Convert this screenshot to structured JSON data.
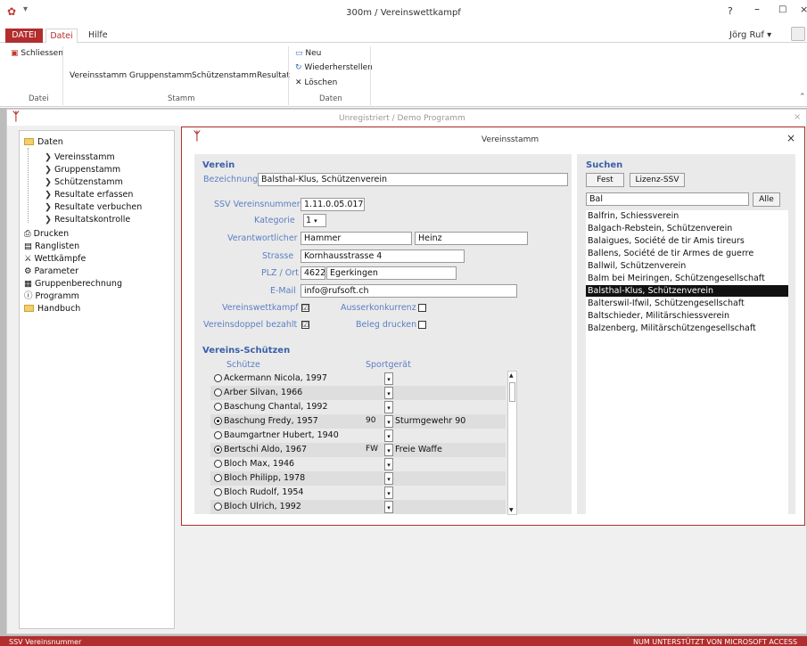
{
  "window": {
    "title": "300m / Vereinswettkampf",
    "help": "?",
    "minimize": "–",
    "maximize": "□",
    "close": "×",
    "user": "Jörg Ruf"
  },
  "ribbon": {
    "tabs": {
      "file": "DATEI",
      "datei": "Datei",
      "hilfe": "Hilfe"
    },
    "buttons": {
      "schliessen": "Schliessen",
      "vereinsstamm": "Vereinsstamm",
      "gruppenstamm": "Gruppenstamm",
      "schuetzenstamm": "Schützenstamm",
      "resultat": "Resultat",
      "neu": "Neu",
      "wiederherstellen": "Wiederherstellen",
      "loeschen": "Löschen"
    },
    "groups": {
      "datei": "Datei",
      "stamm": "Stamm",
      "daten": "Daten"
    }
  },
  "subwindow": {
    "title": "Unregistriert  /  Demo Programm",
    "close": "×"
  },
  "nav": {
    "daten": "Daten",
    "children": [
      "Vereinsstamm",
      "Gruppenstamm",
      "Schützenstamm",
      "Resultate erfassen",
      "Resultate verbuchen",
      "Resultatskontrolle"
    ],
    "drucken": "Drucken",
    "ranglisten": "Ranglisten",
    "wettkaempfe": "Wettkämpfe",
    "parameter": "Parameter",
    "gruppenberechnung": "Gruppenberechnung",
    "programm": "Programm",
    "handbuch": "Handbuch"
  },
  "dialog": {
    "title": "Vereinsstamm",
    "close": "×",
    "verein_section": "Verein",
    "labels": {
      "bezeichnung": "Bezeichnung",
      "ssv": "SSV Vereinsnummer",
      "kategorie": "Kategorie",
      "verantwortlicher": "Verantwortlicher",
      "strasse": "Strasse",
      "plz": "PLZ / Ort",
      "email": "E-Mail",
      "vereinswettkampf": "Vereinswettkampf",
      "ausserkonkurrenz": "Ausserkonkurrenz",
      "vereinsdoppel": "Vereinsdoppel bezahlt",
      "beleg": "Beleg drucken"
    },
    "values": {
      "bezeichnung": "Balsthal-Klus, Schützenverein",
      "ssv": "1.11.0.05.017",
      "kategorie": "1",
      "nachname": "Hammer",
      "vorname": "Heinz",
      "strasse": "Kornhausstrasse 4",
      "plz": "4622",
      "ort": "Egerkingen",
      "email": "info@rufsoft.ch"
    },
    "checks": {
      "vereinswettkampf": "☑",
      "ausserkonkurrenz": "",
      "vereinsdoppel": "☑",
      "beleg": ""
    },
    "schuetzen_section": "Vereins-Schützen",
    "col_schuetze": "Schütze",
    "col_sportgeraet": "Sportgerät",
    "rows": [
      {
        "name": "Ackermann Nicola, 1997",
        "code": "",
        "device": "",
        "selected": false
      },
      {
        "name": "Arber Silvan, 1966",
        "code": "",
        "device": "",
        "selected": false
      },
      {
        "name": "Baschung Chantal, 1992",
        "code": "",
        "device": "",
        "selected": false
      },
      {
        "name": "Baschung Fredy, 1957",
        "code": "90",
        "device": "Sturmgewehr 90",
        "selected": true
      },
      {
        "name": "Baumgartner Hubert, 1940",
        "code": "",
        "device": "",
        "selected": false
      },
      {
        "name": "Bertschi Aldo, 1967",
        "code": "FW",
        "device": "Freie Waffe",
        "selected": true
      },
      {
        "name": "Bloch Max, 1946",
        "code": "",
        "device": "",
        "selected": false
      },
      {
        "name": "Bloch Philipp, 1978",
        "code": "",
        "device": "",
        "selected": false
      },
      {
        "name": "Bloch Rudolf, 1954",
        "code": "",
        "device": "",
        "selected": false
      },
      {
        "name": "Bloch Ulrich, 1992",
        "code": "",
        "device": "",
        "selected": false
      }
    ],
    "search": {
      "section": "Suchen",
      "fest": "Fest",
      "lizenz": "Lizenz-SSV",
      "query": "Bal",
      "alle": "Alle",
      "results": [
        "Balfrin, Schiessverein",
        "Balgach-Rebstein, Schützenverein",
        "Balaigues, Société de tir Amis tireurs",
        "Ballens, Société de tir Armes de guerre",
        "Ballwil, Schützenverein",
        "Balm bei Meiringen, Schützengesellschaft",
        "Balsthal-Klus, Schützenverein",
        "Balterswil-Ifwil, Schützengesellschaft",
        "Baltschieder, Militärschiessverein",
        "Balzenberg, Militärschützengesellschaft"
      ],
      "selected_index": 6
    }
  },
  "status": {
    "left": "SSV Vereinsnummer",
    "right": "NUM    UNTERSTÜTZT VON MICROSOFT ACCESS"
  }
}
